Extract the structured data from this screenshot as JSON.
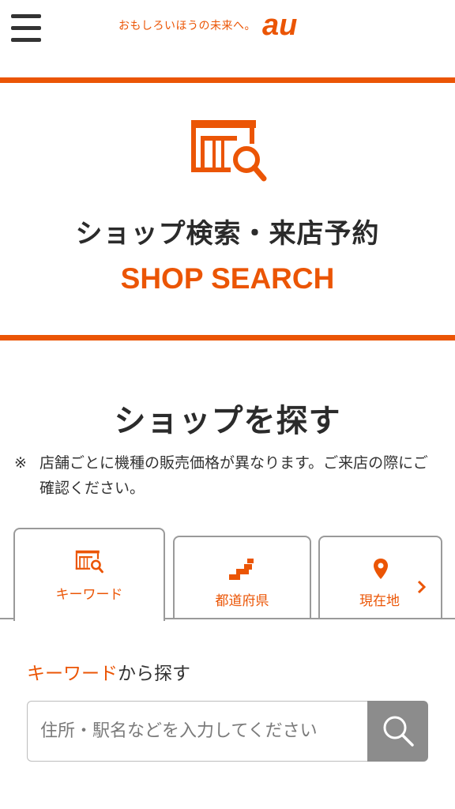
{
  "header": {
    "tagline": "おもしろいほうの未来へ。",
    "logo_text": "au"
  },
  "hero": {
    "title": "ショップ検索・来店予約",
    "subtitle": "SHOP SEARCH"
  },
  "section": {
    "title": "ショップを探す",
    "note_mark": "※",
    "note_text": "店舗ごとに機種の販売価格が異なります。ご来店の際にご確認ください。"
  },
  "tabs": [
    {
      "label": "キーワード",
      "icon": "shop-search-icon"
    },
    {
      "label": "都道府県",
      "icon": "japan-map-icon"
    },
    {
      "label": "現在地",
      "icon": "location-pin-icon"
    }
  ],
  "search": {
    "heading_accent": "キーワード",
    "heading_rest": "から探す",
    "placeholder": "住所・駅名などを入力してください",
    "value": ""
  },
  "colors": {
    "accent": "#eb5505",
    "text": "#333333",
    "button": "#8c8c8c",
    "border": "#9a9a9a"
  }
}
